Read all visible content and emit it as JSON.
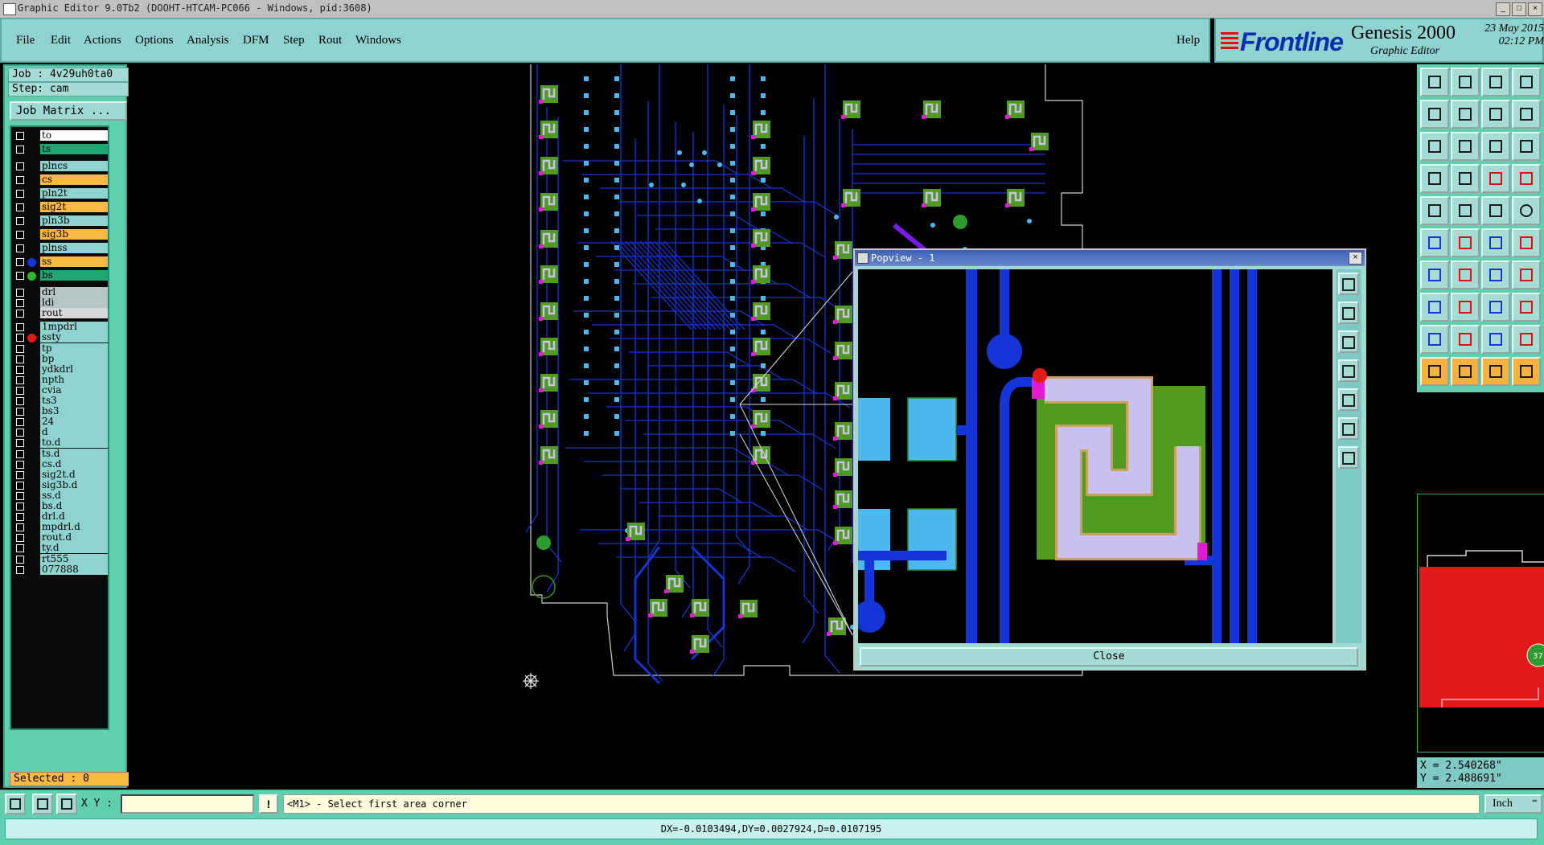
{
  "window": {
    "title": "Graphic Editor 9.0Tb2 (DOOHT-HTCAM-PC066 - Windows, pid:3608)"
  },
  "menu": {
    "items": [
      "File",
      "Edit",
      "Actions",
      "Options",
      "Analysis",
      "DFM",
      "Step",
      "Rout",
      "Windows"
    ],
    "help": "Help"
  },
  "brand": {
    "logo": "Frontline",
    "product": "Genesis 2000",
    "subtitle": "Graphic Editor",
    "date": "23 May 2015",
    "time": "02:12 PM",
    "logo_color": "#0b2fa8"
  },
  "job": {
    "job_line": "Job : 4v29uh0ta0",
    "step_line": "Step: cam",
    "matrix_button": "Job Matrix ..."
  },
  "layers": [
    {
      "name": "to",
      "color": "#ffffff",
      "dot": ""
    },
    {
      "name": "ts",
      "color": "#1fa874",
      "dot": ""
    },
    {
      "name": "plncs",
      "color": "#8fd3d0",
      "dot": ""
    },
    {
      "name": "cs",
      "color": "#f7b940",
      "dot": ""
    },
    {
      "name": "pln2t",
      "color": "#8fd3d0",
      "dot": ""
    },
    {
      "name": "sig2t",
      "color": "#f7b940",
      "dot": ""
    },
    {
      "name": "pln3b",
      "color": "#8fd3d0",
      "dot": ""
    },
    {
      "name": "sig3b",
      "color": "#f7b940",
      "dot": ""
    },
    {
      "name": "plnss",
      "color": "#8fd3d0",
      "dot": ""
    },
    {
      "name": "ss",
      "color": "#f7b940",
      "dot": "#1535d8"
    },
    {
      "name": "bs",
      "color": "#1fa874",
      "dot": "#2fb82f"
    },
    {
      "name": "drl",
      "color": "#b7c4c4",
      "dot": ""
    },
    {
      "name": "ldi",
      "color": "#b7c4c4",
      "dot": ""
    },
    {
      "name": "rout",
      "color": "#d8d8d8",
      "dot": ""
    },
    {
      "name": "1mpdrl",
      "color": "#8fd3d0",
      "dot": ""
    },
    {
      "name": "ssty",
      "color": "#8fd3d0",
      "dot": "#e21a1a"
    },
    {
      "name": "tp",
      "color": "#8fd3d0",
      "dot": ""
    },
    {
      "name": "bp",
      "color": "#8fd3d0",
      "dot": ""
    },
    {
      "name": "ydkdrl",
      "color": "#8fd3d0",
      "dot": ""
    },
    {
      "name": "npth",
      "color": "#8fd3d0",
      "dot": ""
    },
    {
      "name": "cvia",
      "color": "#8fd3d0",
      "dot": ""
    },
    {
      "name": "ts3",
      "color": "#8fd3d0",
      "dot": ""
    },
    {
      "name": "bs3",
      "color": "#8fd3d0",
      "dot": ""
    },
    {
      "name": "24",
      "color": "#8fd3d0",
      "dot": ""
    },
    {
      "name": "d",
      "color": "#8fd3d0",
      "dot": ""
    },
    {
      "name": "to.d",
      "color": "#8fd3d0",
      "dot": ""
    },
    {
      "name": "ts.d",
      "color": "#8fd3d0",
      "dot": ""
    },
    {
      "name": "cs.d",
      "color": "#8fd3d0",
      "dot": ""
    },
    {
      "name": "sig2t.d",
      "color": "#8fd3d0",
      "dot": ""
    },
    {
      "name": "sig3b.d",
      "color": "#8fd3d0",
      "dot": ""
    },
    {
      "name": "ss.d",
      "color": "#8fd3d0",
      "dot": ""
    },
    {
      "name": "bs.d",
      "color": "#8fd3d0",
      "dot": ""
    },
    {
      "name": "drl.d",
      "color": "#8fd3d0",
      "dot": ""
    },
    {
      "name": "mpdrl.d",
      "color": "#8fd3d0",
      "dot": ""
    },
    {
      "name": "rout.d",
      "color": "#8fd3d0",
      "dot": ""
    },
    {
      "name": "ty.d",
      "color": "#8fd3d0",
      "dot": ""
    },
    {
      "name": "rt555",
      "color": "#8fd3d0",
      "dot": ""
    },
    {
      "name": "077888",
      "color": "#8fd3d0",
      "dot": ""
    }
  ],
  "selected": "Selected : 0",
  "popview": {
    "title": "Popview - 1",
    "close_button": "Close"
  },
  "coords": {
    "x": "X = 2.540268\"",
    "y": "Y = 2.488691\""
  },
  "minimap": {
    "badge": "37"
  },
  "bottom": {
    "xy_label": "X Y :",
    "xy_value": "",
    "warn": "!",
    "prompt": "<M1> - Select first area corner",
    "unit": "Inch"
  },
  "status": "DX=-0.0103494,DY=0.0027924,D=0.0107195",
  "colors": {
    "trace": "#1535d8",
    "pad": "#4fb7ef",
    "smd": "#4f9a1f",
    "highlight": "#c9c0ee",
    "arrow": "#7a18e6",
    "panel": "#5fcfb0",
    "menu": "#8fd3d0"
  }
}
